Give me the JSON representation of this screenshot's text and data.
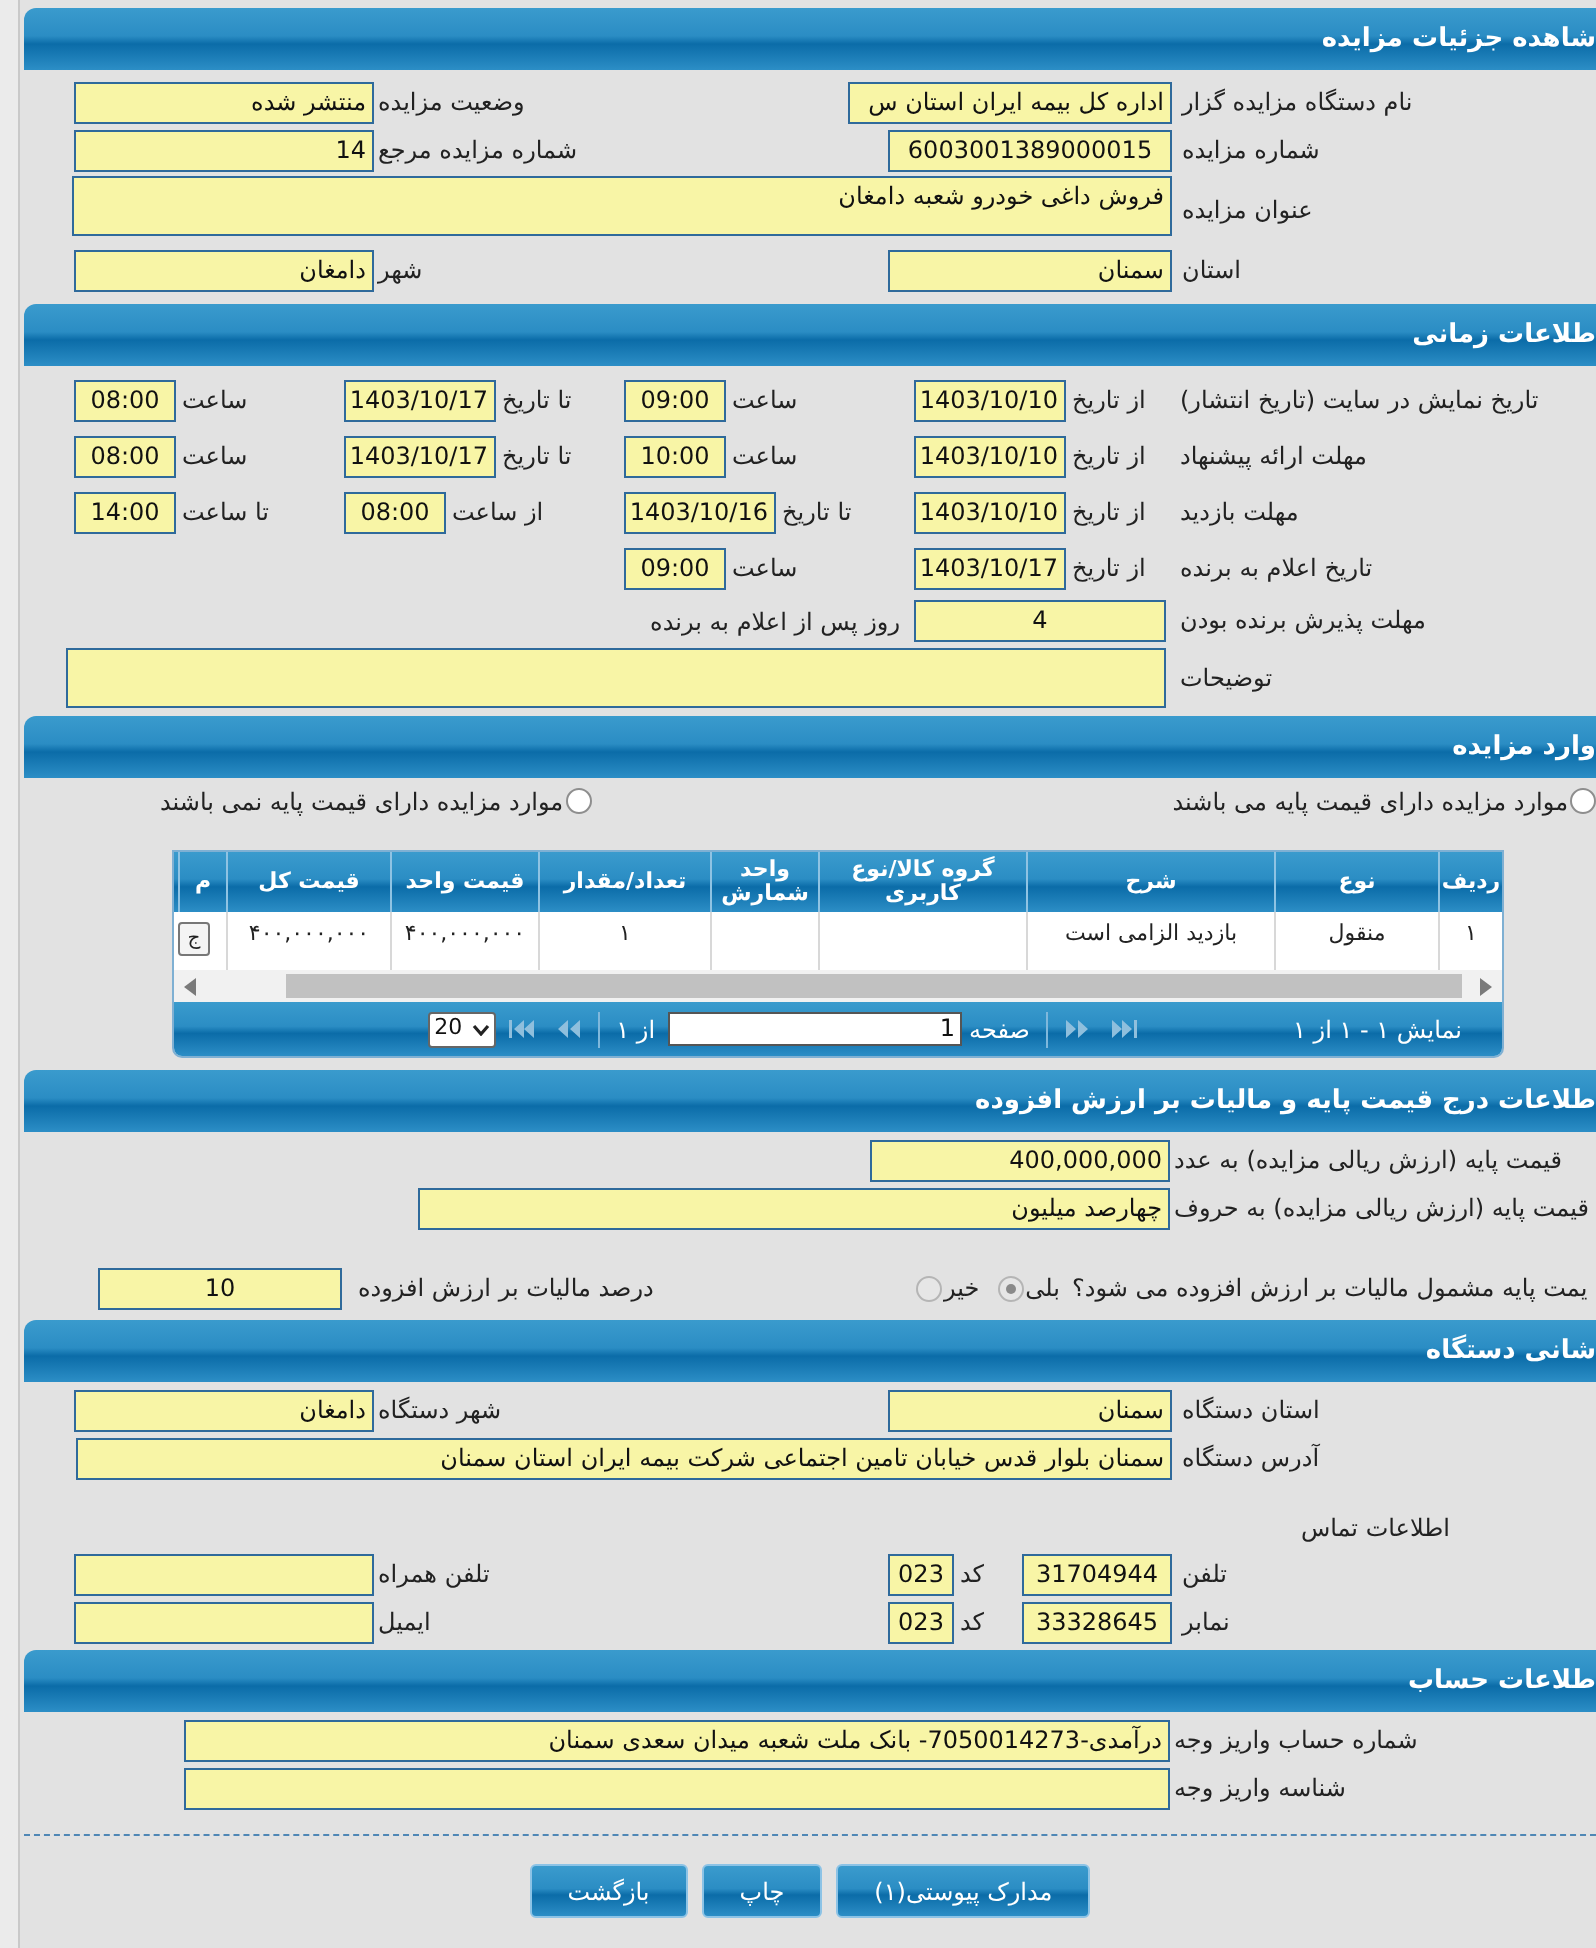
{
  "auction_details": {
    "title": "شاهده جزئیات مزایده",
    "fields": [
      {
        "label": "نام دستگاه مزایده گزار",
        "value": "اداره کل بیمه ایران استان س"
      },
      {
        "label": "وضعیت مزایده",
        "value": "منتشر شده"
      },
      {
        "label": "شماره مزایده",
        "value": "6003001389000015"
      },
      {
        "label": "شماره مزایده مرجع",
        "value": "14"
      },
      {
        "label": "عنوان مزایده",
        "value": "فروش داغی خودرو شعبه دامغان"
      },
      {
        "label": "استان",
        "value": "سمنان"
      },
      {
        "label": "شهر",
        "value": "دامغان"
      }
    ]
  },
  "timing": {
    "title": "طلاعات زمانی",
    "rows": [
      {
        "label": "تاریخ نمایش در سایت (تاریخ انتشار)",
        "pairs": [
          {
            "kind": "date",
            "label": "از تاریخ",
            "value": "1403/10/10"
          },
          {
            "kind": "time",
            "label": "ساعت",
            "value": "09:00"
          },
          {
            "kind": "date",
            "label": "تا تاریخ",
            "value": "1403/10/17"
          },
          {
            "kind": "time",
            "label": "ساعت",
            "value": "08:00"
          }
        ]
      },
      {
        "label": "مهلت ارائه پیشنهاد",
        "pairs": [
          {
            "kind": "date",
            "label": "از تاریخ",
            "value": "1403/10/10"
          },
          {
            "kind": "time",
            "label": "ساعت",
            "value": "10:00"
          },
          {
            "kind": "date",
            "label": "تا تاریخ",
            "value": "1403/10/17"
          },
          {
            "kind": "time",
            "label": "ساعت",
            "value": "08:00"
          }
        ]
      },
      {
        "label": "مهلت بازدید",
        "pairs": [
          {
            "kind": "date",
            "label": "از تاریخ",
            "value": "1403/10/10"
          },
          {
            "kind": "date",
            "label": "تا تاریخ",
            "value": "1403/10/16"
          },
          {
            "kind": "time",
            "label": "از ساعت",
            "value": "08:00"
          },
          {
            "kind": "time",
            "label": "تا ساعت",
            "value": "14:00"
          }
        ]
      },
      {
        "label": "تاریخ اعلام به برنده",
        "pairs": [
          {
            "kind": "date",
            "label": "از تاریخ",
            "value": "1403/10/17"
          },
          {
            "kind": "time",
            "label": "ساعت",
            "value": "09:00"
          }
        ]
      }
    ],
    "acceptance": {
      "label": "مهلت پذیرش برنده بودن",
      "value": "4",
      "suffix": "روز پس از اعلام به برنده"
    },
    "notes": {
      "label": "توضیحات"
    }
  },
  "items": {
    "title": "وارد مزایده",
    "options": [
      {
        "label": "موارد مزایده دارای قیمت پایه می باشند",
        "selected": false
      },
      {
        "label": "موارد مزایده دارای قیمت پایه نمی باشند",
        "selected": false
      }
    ],
    "table": {
      "columns": [
        "ردیف",
        "نوع",
        "شرح",
        "گروه کالا/نوع کاربری",
        "واحد شمارش",
        "تعداد/مقدار",
        "قیمت واحد",
        "قیمت کل",
        "م"
      ],
      "rows": [
        {
          "cells": [
            "۱",
            "منقول",
            "بازدید الزامی است",
            null,
            null,
            "۱",
            "۴۰۰,۰۰۰,۰۰۰",
            "۴۰۰,۰۰۰,۰۰۰"
          ],
          "action": "ج"
        }
      ]
    },
    "pager": {
      "summary": "نمایش ۱ - ۱ از ۱",
      "page_label": "صفحه",
      "page": "1",
      "of_label": "از ۱",
      "page_size": "20"
    }
  },
  "pricing": {
    "title": "طلاعات درج قیمت پایه و مالیات بر ارزش افزوده",
    "amount": {
      "label": "قیمت پایه (ارزش ریالی مزایده) به عدد",
      "value": "400,000,000"
    },
    "amount_words": {
      "label": "قیمت پایه (ارزش ریالی مزایده) به حروف",
      "value": "چهارصد میلیون"
    },
    "vat_question": {
      "label": "یمت پایه مشمول مالیات بر ارزش افزوده می شود؟",
      "options": [
        {
          "label": "بلی",
          "selected": true
        },
        {
          "label": "خیر",
          "selected": false
        }
      ]
    },
    "vat_percent": {
      "label": "درصد مالیات بر ارزش افزوده",
      "value": "10"
    }
  },
  "device": {
    "title": "شانی دستگاه",
    "fields": [
      {
        "label": "استان دستگاه",
        "value": "سمنان"
      },
      {
        "label": "شهر دستگاه",
        "value": "دامغان"
      },
      {
        "label": "آدرس دستگاه",
        "value": "سمنان بلوار قدس خیابان تامین اجتماعی شرکت بیمه ایران استان سمنان"
      }
    ],
    "contact_title": "اطلاعات تماس",
    "contacts": [
      {
        "label": "تلفن",
        "value": "31704944",
        "code_label": "کد",
        "code": "023",
        "other_label": "تلفن همراه"
      },
      {
        "label": "نمابر",
        "value": "33328645",
        "code_label": "کد",
        "code": "023",
        "other_label": "ایمیل"
      }
    ]
  },
  "account": {
    "title": "طلاعات حساب",
    "fields": [
      {
        "label": "شماره حساب واریز وجه",
        "value": "درآمدی-7050014273- بانک ملت شعبه میدان سعدی سمنان"
      },
      {
        "label": "شناسه واریز وجه"
      }
    ]
  },
  "buttons": [
    "مدارک پیوستی(۱)",
    "چاپ",
    "بازگشت"
  ]
}
